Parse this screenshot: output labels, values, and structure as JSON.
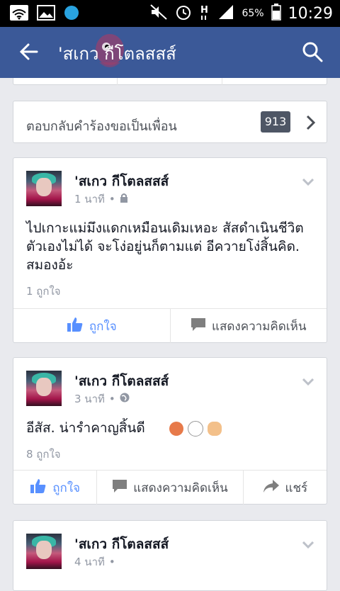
{
  "status_bar": {
    "battery": "65%",
    "time": "10:29"
  },
  "app_bar": {
    "title": "'สเกว กีโตลสสส์"
  },
  "friend_requests": {
    "label": "ตอบกลับคำร้องขอเป็นเพื่อน",
    "count": "913"
  },
  "posts": [
    {
      "author": "'สเกว กีโตลสสส์",
      "time": "1 นาที",
      "privacy_icon": "lock-icon",
      "text": "ไปเกาะแม่มึงแดกเหมือนเดิมเหอะ สัสดำเนินชีวิตตัวเองไม่ได้  จะโง่อยู่นก็ตามแต่ อีควายโง่สิ้นคิด. สมองอ้ะ",
      "likes": "1 ถูกใจ",
      "actions": {
        "like": "ถูกใจ",
        "comment": "แสดงความคิดเห็น"
      }
    },
    {
      "author": "'สเกว กีโตลสสส์",
      "time": "3 นาที",
      "privacy_icon": "globe-icon",
      "text": "อีสัส. น่ารำคาญสิ้นดี",
      "likes": "8 ถูกใจ",
      "actions": {
        "like": "ถูกใจ",
        "comment": "แสดงความคิดเห็น",
        "share": "แชร์"
      }
    },
    {
      "author": "'สเกว กีโตลสสส์",
      "time": "4 นาที"
    }
  ],
  "colors": {
    "brand": "#3b5998",
    "like": "#5890ff",
    "background": "#e9eaee"
  }
}
